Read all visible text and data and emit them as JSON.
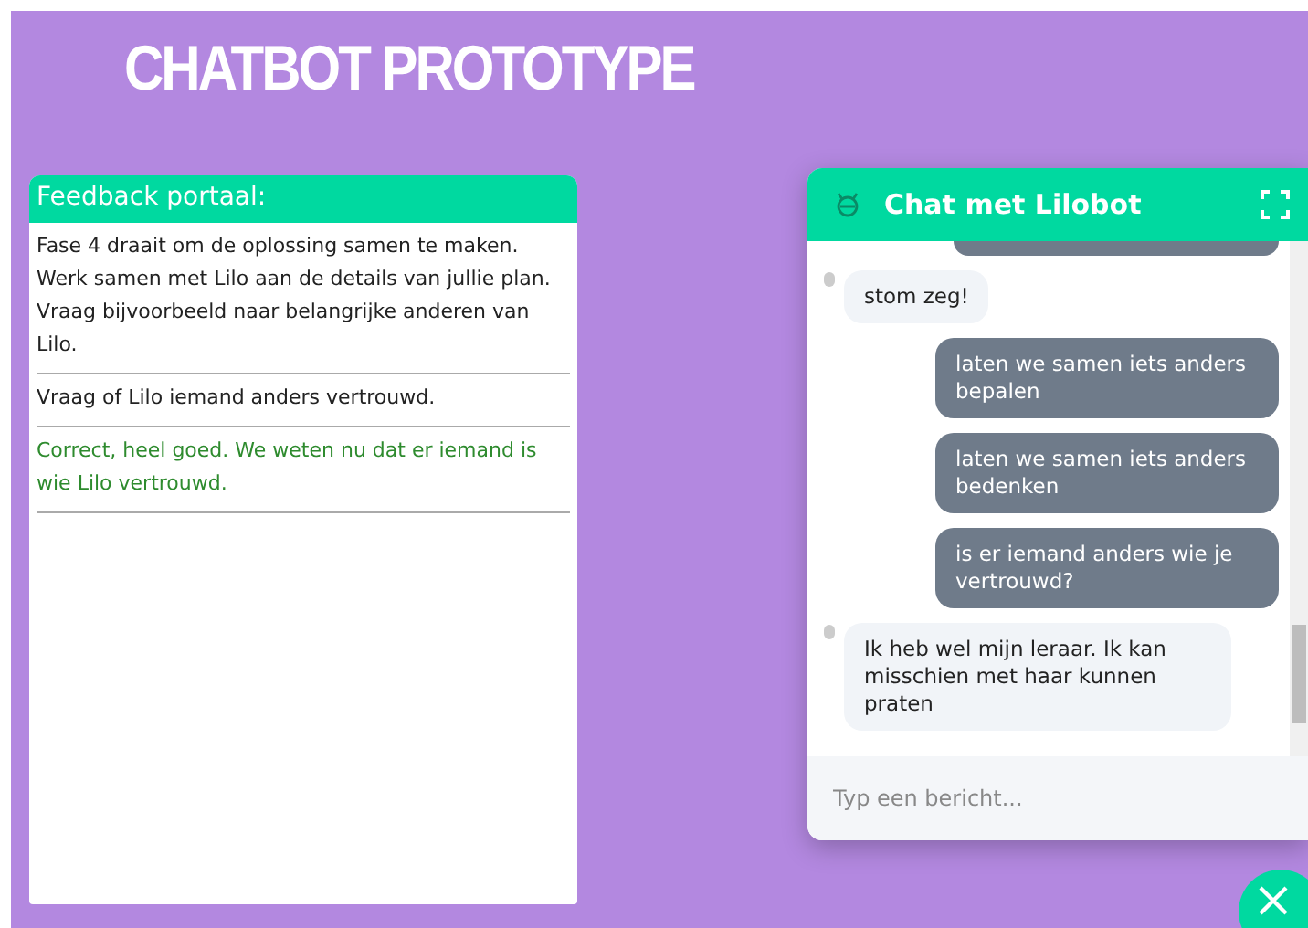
{
  "page_title": "CHATBOT PROTOTYPE",
  "feedback": {
    "title": "Feedback portaal:",
    "items": [
      {
        "kind": "info",
        "text": "Fase 4 draait om de oplossing samen te maken. Werk samen met Lilo aan de details van jullie plan. Vraag bijvoorbeeld naar belangrijke anderen van Lilo."
      },
      {
        "kind": "info",
        "text": "Vraag of Lilo iemand anders vertrouwd."
      },
      {
        "kind": "correct",
        "text": "Correct, heel goed. We weten nu dat er iemand is wie Lilo vertrouwd."
      }
    ]
  },
  "chat": {
    "title": "Chat met Lilobot",
    "messages": [
      {
        "kind": "bot",
        "text": "stom zeg!"
      },
      {
        "kind": "user",
        "text": "laten we samen iets anders bepalen"
      },
      {
        "kind": "user",
        "text": "laten we samen iets anders bedenken"
      },
      {
        "kind": "user",
        "text": "is er iemand anders wie je vertrouwd?"
      },
      {
        "kind": "bot",
        "text": "Ik heb wel mijn leraar. Ik kan misschien met haar kunnen praten"
      }
    ],
    "input": {
      "placeholder": "Typ een bericht..."
    }
  }
}
